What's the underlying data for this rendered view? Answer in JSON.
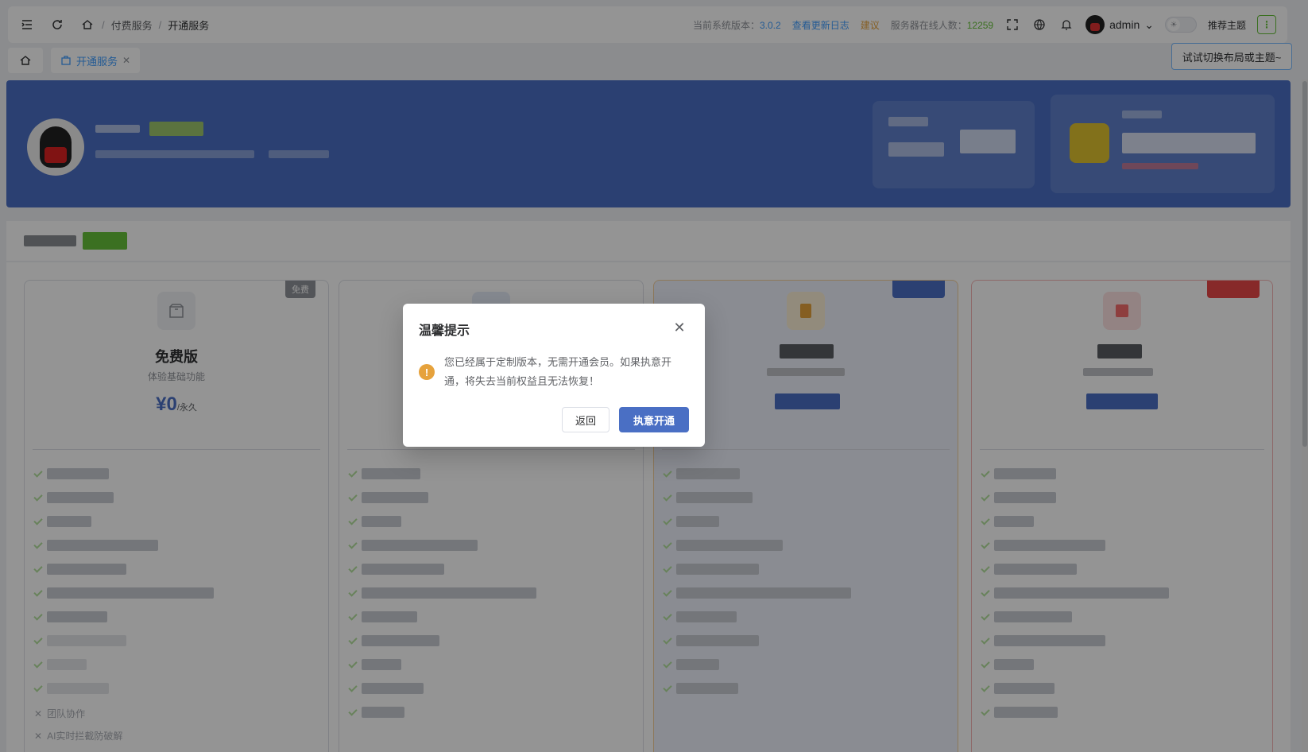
{
  "header": {
    "breadcrumb": [
      "付费服务",
      "开通服务"
    ],
    "version_label": "当前系统版本：",
    "version": "3.0.2",
    "changelog_link": "查看更新日志",
    "suggest_link": "建议",
    "online_label": "服务器在线人数：",
    "online_count": "12259",
    "username": "admin",
    "theme_label": "推荐主题"
  },
  "tabs": {
    "active": "开通服务"
  },
  "tooltip": "试试切换布局或主题~",
  "cards": [
    {
      "badge": "免费",
      "title": "免费版",
      "subtitle": "体验基础功能",
      "price": "¥0",
      "period": "/永久",
      "disabled_features": [
        "团队协作",
        "AI实时拦截防破解"
      ]
    }
  ],
  "dialog": {
    "title": "温馨提示",
    "message": "您已经属于定制版本，无需开通会员。如果执意开通，将失去当前权益且无法恢复！",
    "cancel_label": "返回",
    "confirm_label": "执意开通"
  },
  "colors": {
    "primary": "#4a6fc4",
    "warning": "#e6a23c",
    "link": "#409eff",
    "success": "#67c23a"
  }
}
